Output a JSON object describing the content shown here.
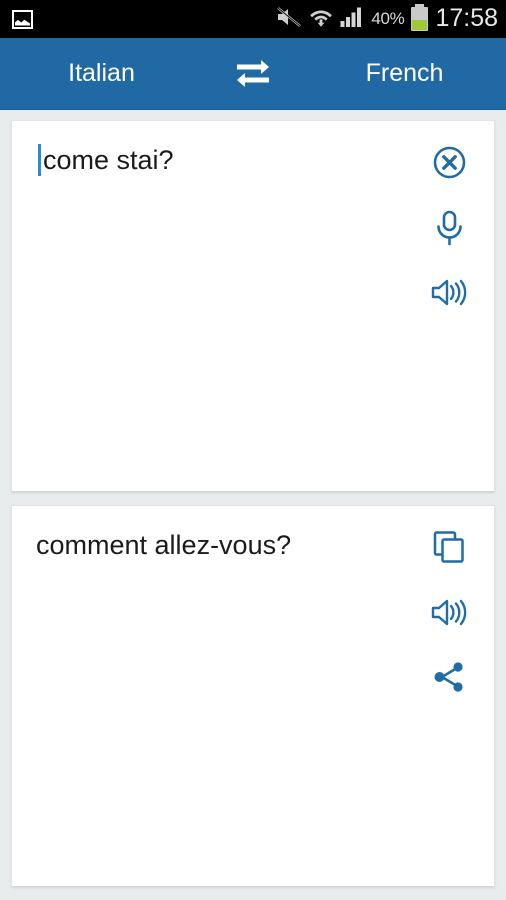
{
  "status_bar": {
    "left_icons": [
      {
        "name": "gallery-image-icon",
        "label": "image"
      }
    ],
    "right_icons": [
      {
        "name": "mute-icon",
        "label": "silent"
      },
      {
        "name": "wifi-transfer-icon",
        "label": "wifi"
      },
      {
        "name": "signal-bars-icon",
        "label": "signal"
      }
    ],
    "battery_percent": "40%",
    "clock": "17:58"
  },
  "language_bar": {
    "source_language": "Italian",
    "target_language": "French",
    "swap_icon": "swap-arrows-icon",
    "background_color": "#2069a4"
  },
  "input_card": {
    "text": "come stai?",
    "caret_visible": true,
    "actions": [
      {
        "name": "clear-button",
        "icon": "clear-circle-x-icon",
        "label": "Clear"
      },
      {
        "name": "voice-input-button",
        "icon": "microphone-icon",
        "label": "Speak"
      },
      {
        "name": "listen-source-button",
        "icon": "speaker-volume-icon",
        "label": "Listen"
      }
    ]
  },
  "output_card": {
    "text": "comment allez-vous?",
    "actions": [
      {
        "name": "copy-button",
        "icon": "copy-icon",
        "label": "Copy"
      },
      {
        "name": "listen-translation-button",
        "icon": "speaker-volume-icon",
        "label": "Listen"
      },
      {
        "name": "share-button",
        "icon": "share-icon",
        "label": "Share"
      }
    ]
  },
  "theme": {
    "accent": "#2069a4",
    "icon_blue": "#1f6ca6",
    "caret_blue": "#2b8bd8",
    "page_background": "#e9ecec",
    "card_background": "#ffffff",
    "status_bar_background": "#000000"
  }
}
